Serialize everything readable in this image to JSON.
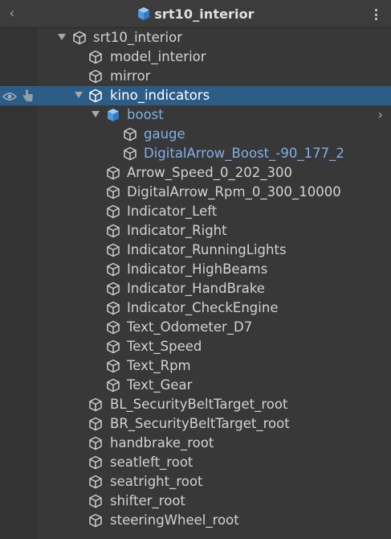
{
  "header": {
    "title": "srt10_interior",
    "back_icon": "chevron-left-icon",
    "more_icon": "vertical-ellipsis-icon"
  },
  "tree": {
    "rows": [
      {
        "label": "srt10_interior",
        "depth": 0,
        "expanded": true,
        "icon": "gameobject-outline-icon"
      },
      {
        "label": "model_interior",
        "depth": 1,
        "icon": "gameobject-outline-icon"
      },
      {
        "label": "mirror",
        "depth": 1,
        "icon": "gameobject-outline-icon"
      },
      {
        "label": "kino_indicators",
        "depth": 1,
        "expanded": true,
        "selected": true,
        "icon": "gameobject-outline-icon"
      },
      {
        "label": "boost",
        "depth": 2,
        "expanded": true,
        "prefab": true,
        "icon": "prefab-cube-icon"
      },
      {
        "label": "gauge",
        "depth": 3,
        "prefab_child": true,
        "icon": "gameobject-outline-icon"
      },
      {
        "label": "DigitalArrow_Boost_-90_177_2",
        "depth": 3,
        "prefab_child": true,
        "icon": "gameobject-outline-icon"
      },
      {
        "label": "Arrow_Speed_0_202_300",
        "depth": 2,
        "icon": "gameobject-outline-icon"
      },
      {
        "label": "DigitalArrow_Rpm_0_300_10000",
        "depth": 2,
        "icon": "gameobject-outline-icon"
      },
      {
        "label": "Indicator_Left",
        "depth": 2,
        "icon": "gameobject-outline-icon"
      },
      {
        "label": "Indicator_Right",
        "depth": 2,
        "icon": "gameobject-outline-icon"
      },
      {
        "label": "Indicator_RunningLights",
        "depth": 2,
        "icon": "gameobject-outline-icon"
      },
      {
        "label": "Indicator_HighBeams",
        "depth": 2,
        "icon": "gameobject-outline-icon"
      },
      {
        "label": "Indicator_HandBrake",
        "depth": 2,
        "icon": "gameobject-outline-icon"
      },
      {
        "label": "Indicator_CheckEngine",
        "depth": 2,
        "icon": "gameobject-outline-icon"
      },
      {
        "label": "Text_Odometer_D7",
        "depth": 2,
        "icon": "gameobject-outline-icon"
      },
      {
        "label": "Text_Speed",
        "depth": 2,
        "icon": "gameobject-outline-icon"
      },
      {
        "label": "Text_Rpm",
        "depth": 2,
        "icon": "gameobject-outline-icon"
      },
      {
        "label": "Text_Gear",
        "depth": 2,
        "icon": "gameobject-outline-icon"
      },
      {
        "label": "BL_SecurityBeltTarget_root",
        "depth": 1,
        "icon": "gameobject-outline-icon"
      },
      {
        "label": "BR_SecurityBeltTarget_root",
        "depth": 1,
        "icon": "gameobject-outline-icon"
      },
      {
        "label": "handbrake_root",
        "depth": 1,
        "icon": "gameobject-outline-icon"
      },
      {
        "label": "seatleft_root",
        "depth": 1,
        "icon": "gameobject-outline-icon"
      },
      {
        "label": "seatright_root",
        "depth": 1,
        "icon": "gameobject-outline-icon"
      },
      {
        "label": "shifter_root",
        "depth": 1,
        "icon": "gameobject-outline-icon"
      },
      {
        "label": "steeringWheel_root",
        "depth": 1,
        "icon": "gameobject-outline-icon"
      }
    ]
  },
  "selected_row": {
    "visibility_icon": "eye-icon",
    "pickability_icon": "hand-pointer-icon"
  },
  "prefab_row": {
    "open_icon": "chevron-right-icon"
  },
  "colors": {
    "background": "#383838",
    "gutter": "#333333",
    "selection": "#2c5d87",
    "prefab_text": "#7fb0e8",
    "text": "#d2d2d2"
  }
}
